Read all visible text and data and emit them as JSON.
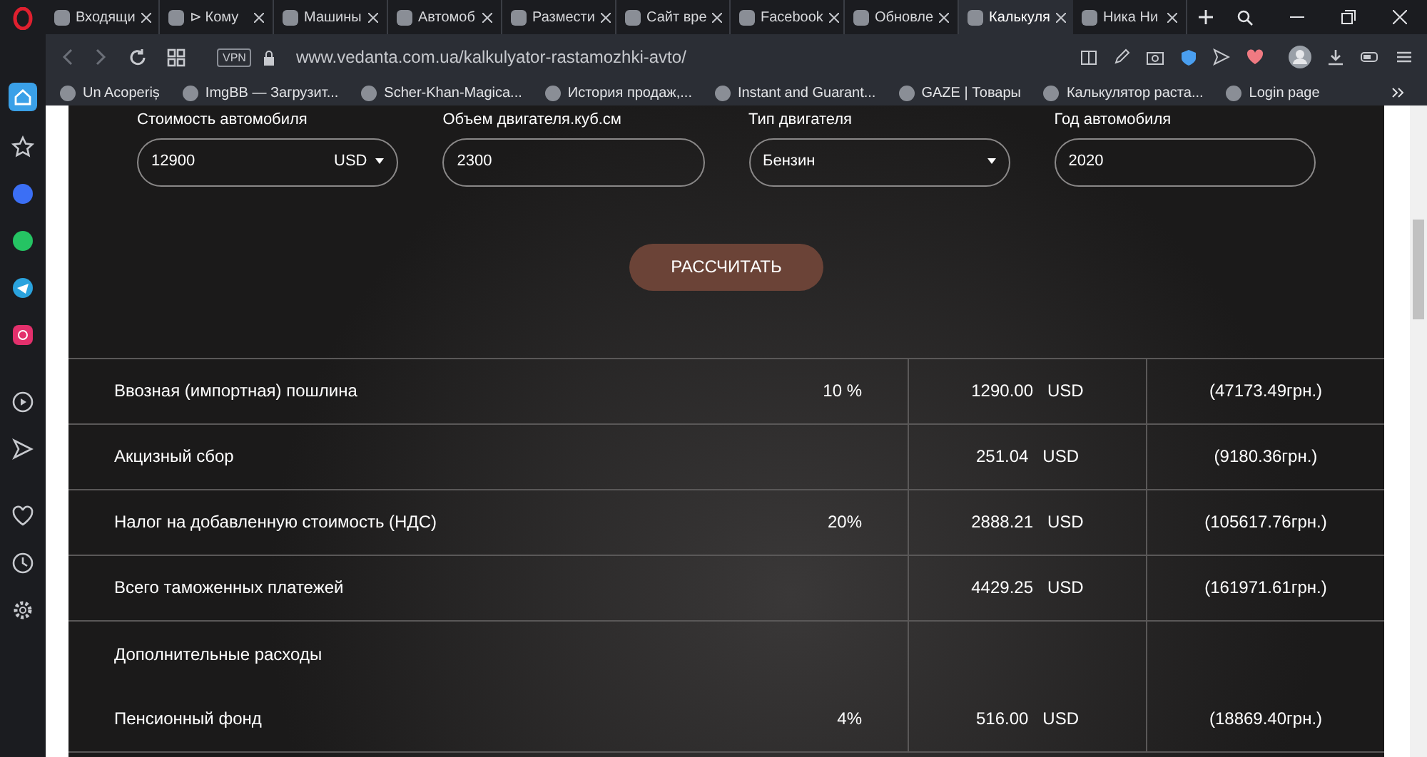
{
  "tabs": [
    {
      "title": "Входящи",
      "selected": false
    },
    {
      "title": "⊳ Кому",
      "selected": false
    },
    {
      "title": "Машины",
      "selected": false
    },
    {
      "title": "Автомоб",
      "selected": false
    },
    {
      "title": "Размести",
      "selected": false
    },
    {
      "title": "Сайт вре",
      "selected": false
    },
    {
      "title": "Facebook",
      "selected": false
    },
    {
      "title": "Обновле",
      "selected": false
    },
    {
      "title": "Калькуля",
      "selected": true
    },
    {
      "title": "Ника Ни",
      "selected": false
    }
  ],
  "address_bar": {
    "vpn": "VPN",
    "url": "www.vedanta.com.ua/kalkulyator-rastamozhki-avto/"
  },
  "bookmarks": [
    "Un Acoperiș",
    "ImgBB — Загрузит...",
    "Scher-Khan-Magica...",
    "История продаж,...",
    "Instant and Guarant...",
    "GAZE | Товары",
    "Калькулятор раста...",
    "Login page"
  ],
  "form": {
    "fields": [
      {
        "label": "Стоимость автомобиля",
        "kind": "money",
        "value": "12900",
        "currency": "USD"
      },
      {
        "label": "Объем двигателя.куб.см",
        "kind": "text",
        "value": "2300"
      },
      {
        "label": "Тип двигателя",
        "kind": "select",
        "value": "Бензин"
      },
      {
        "label": "Год автомобиля",
        "kind": "text",
        "value": "2020"
      }
    ],
    "button": "РАССЧИТАТЬ"
  },
  "table": {
    "rows": [
      {
        "kind": "line",
        "name": "Ввозная (импортная) пошлина",
        "rate": "10 %",
        "amount": "1290.00",
        "currency": "USD",
        "uah": "(47173.49грн.)"
      },
      {
        "kind": "line",
        "name": "Акцизный сбор",
        "amount": "251.04",
        "currency": "USD",
        "uah": "(9180.36грн.)"
      },
      {
        "kind": "line",
        "name": "Налог на добавленную стоимость (НДС)",
        "rate": "20%",
        "amount": "2888.21",
        "currency": "USD",
        "uah": "(105617.76грн.)"
      },
      {
        "kind": "line",
        "name": "Всего таможенных платежей",
        "amount": "4429.25",
        "currency": "USD",
        "uah": "(161971.61грн.)"
      },
      {
        "kind": "section",
        "name": "Дополнительные расходы"
      },
      {
        "kind": "line",
        "name": "Пенсионный фонд",
        "rate": "4%",
        "amount": "516.00",
        "currency": "USD",
        "uah": "(18869.40грн.)"
      }
    ]
  }
}
